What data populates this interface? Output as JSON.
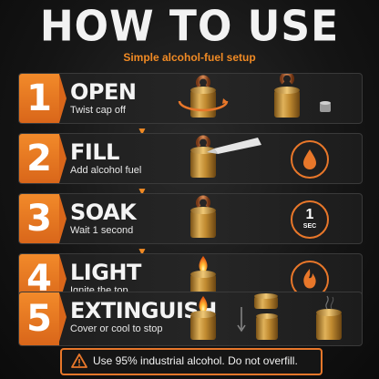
{
  "header": {
    "title": "HOW TO USE",
    "subtitle": "Simple alcohol-fuel setup"
  },
  "steps": [
    {
      "number": "1",
      "title": "OPEN",
      "description": "Twist cap off",
      "icon": "twist-cap-icon"
    },
    {
      "number": "2",
      "title": "FILL",
      "description": "Add alcohol fuel",
      "icon": "fuel-drop-icon"
    },
    {
      "number": "3",
      "title": "SOAK",
      "description": "Wait 1 second",
      "icon": "timer-icon",
      "timer_value": "1",
      "timer_unit": "SEC"
    },
    {
      "number": "4",
      "title": "LIGHT",
      "description": "Ignite the top",
      "icon": "flame-icon"
    },
    {
      "number": "5",
      "title": "EXTINGUISH",
      "description": "Cover or cool to stop",
      "icon": "snuffer-icon"
    }
  ],
  "warning": {
    "icon": "warning-triangle-icon",
    "text": "Use 95% industrial alcohol. Do not overfill."
  },
  "colors": {
    "accent": "#e8772a",
    "brass": "#c9932f",
    "copper": "#b5652f",
    "background": "#141414"
  }
}
